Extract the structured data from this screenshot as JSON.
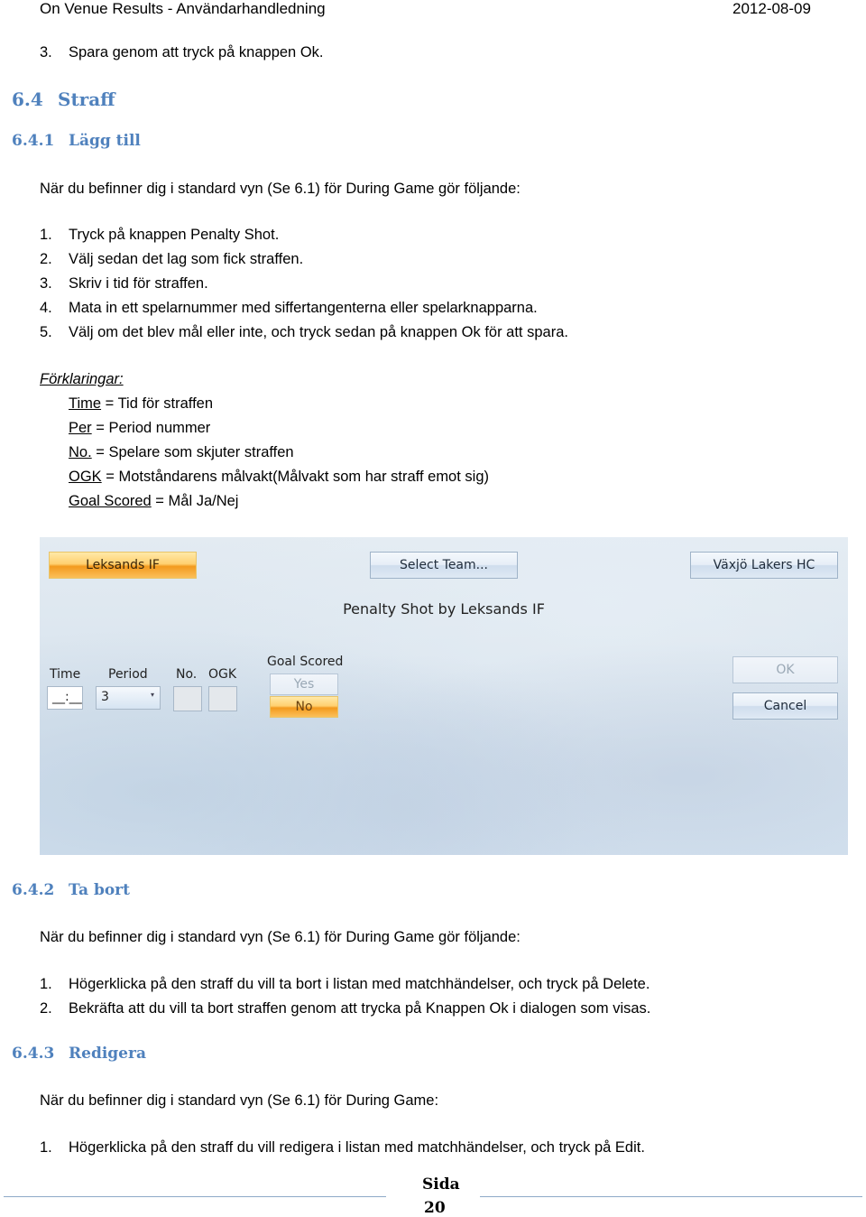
{
  "header": {
    "title": "On Venue Results - Användarhandledning",
    "date": "2012-08-09"
  },
  "prev_step": {
    "number": "3.",
    "text": "Spara genom att tryck på knappen Ok."
  },
  "section_6_4": {
    "number": "6.4",
    "title": "Straff"
  },
  "section_6_4_1": {
    "number": "6.4.1",
    "title": "Lägg till",
    "intro": "När du befinner dig i standard vyn (Se 6.1) för During Game gör följande:",
    "steps": [
      {
        "number": "1.",
        "text": "Tryck på knappen Penalty Shot."
      },
      {
        "number": "2.",
        "text": "Välj sedan det lag som fick straffen."
      },
      {
        "number": "3.",
        "text": "Skriv i tid för straffen."
      },
      {
        "number": "4.",
        "text": "Mata in ett spelarnummer med siffertangenterna eller spelarknapparna."
      },
      {
        "number": "5.",
        "text": "Välj om det blev mål eller inte, och tryck sedan på knappen Ok för att spara."
      }
    ],
    "legend": {
      "title": "Förklaringar:",
      "items": [
        {
          "term": "Time",
          "definition": " = Tid för straffen"
        },
        {
          "term": "Per",
          "definition": " = Period nummer"
        },
        {
          "term": "No.",
          "definition": " = Spelare som skjuter straffen"
        },
        {
          "term": "OGK",
          "definition": " = Motståndarens målvakt(Målvakt som har straff emot sig)"
        },
        {
          "term": "Goal Scored",
          "definition": " = Mål Ja/Nej"
        }
      ]
    }
  },
  "dialog": {
    "home_team_button": "Leksands IF",
    "select_team_button": "Select Team...",
    "away_team_button": "Växjö Lakers HC",
    "caption": "Penalty Shot by Leksands IF",
    "time_label": "Time",
    "time_value": "__:__",
    "period_label": "Period",
    "period_value": "3",
    "no_label": "No.",
    "ogk_label": "OGK",
    "goal_scored_label": "Goal Scored",
    "yes_button": "Yes",
    "no_button": "No",
    "ok_button": "OK",
    "cancel_button": "Cancel",
    "accent_orange": "#f39a1e",
    "button_blue": "#dfe9f4"
  },
  "section_6_4_2": {
    "number": "6.4.2",
    "title": "Ta bort",
    "intro": "När du befinner dig i standard vyn (Se 6.1) för During Game gör följande:",
    "steps": [
      {
        "number": "1.",
        "text": "Högerklicka på den straff du vill ta bort i listan med matchhändelser, och tryck på Delete."
      },
      {
        "number": "2.",
        "text": "Bekräfta att du vill ta bort straffen genom att trycka på Knappen Ok i dialogen som visas."
      }
    ]
  },
  "section_6_4_3": {
    "number": "6.4.3",
    "title": "Redigera",
    "intro": "När du befinner dig i standard vyn (Se 6.1) för During Game:",
    "steps": [
      {
        "number": "1.",
        "text": "Högerklicka på den straff du vill redigera i listan med matchhändelser, och tryck på Edit."
      }
    ]
  },
  "footer": {
    "page_label": "Sida",
    "page_number": "20"
  },
  "colors": {
    "heading": "#4f81bd",
    "footer_rule": "#8eaac8"
  }
}
